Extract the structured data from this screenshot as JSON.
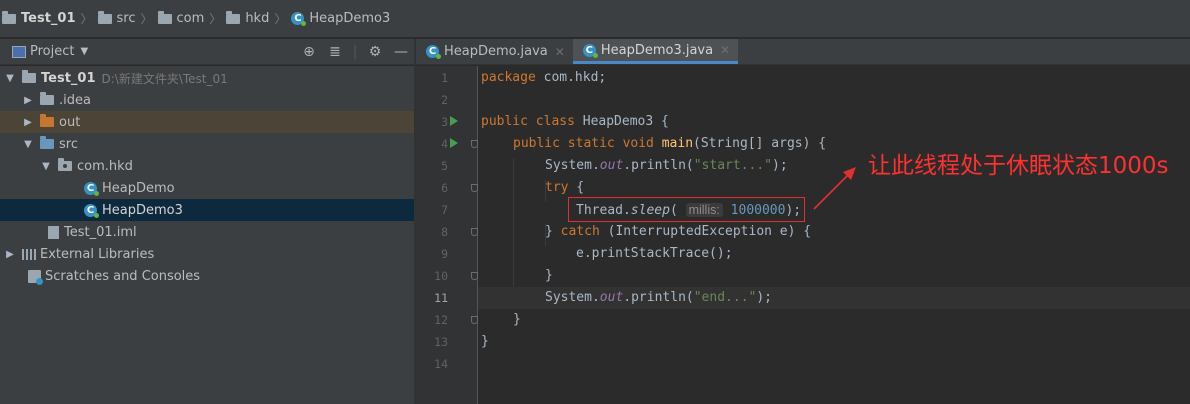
{
  "breadcrumb": {
    "project": "Test_01",
    "items": [
      "src",
      "com",
      "hkd"
    ],
    "file": "HeapDemo3"
  },
  "project_panel": {
    "title": "Project",
    "tree": {
      "root_name": "Test_01",
      "root_path": "D:\\新建文件夹\\Test_01",
      "idea": ".idea",
      "out": "out",
      "src": "src",
      "package": "com.hkd",
      "class1": "HeapDemo",
      "class2": "HeapDemo3",
      "iml": "Test_01.iml",
      "external": "External Libraries",
      "scratches": "Scratches and Consoles"
    }
  },
  "editor": {
    "tabs": [
      {
        "label": "HeapDemo.java",
        "active": false
      },
      {
        "label": "HeapDemo3.java",
        "active": true
      }
    ],
    "line_numbers": [
      "1",
      "2",
      "3",
      "4",
      "5",
      "6",
      "7",
      "8",
      "9",
      "10",
      "11",
      "12",
      "13",
      "14"
    ],
    "current_line": "11",
    "code": {
      "l1_kw": "package",
      "l1_rest": " com.hkd;",
      "l3_kw": "public class",
      "l3_rest": " HeapDemo3 {",
      "l4_kw": "public static void",
      "l4_fn": "main",
      "l4_rest": "(String[] args) {",
      "l5_a": "System.",
      "l5_out": "out",
      "l5_b": ".println(",
      "l5_str": "\"start...\"",
      "l5_c": ");",
      "l6_kw": "try",
      "l6_rest": " {",
      "l7_a": "Thread.",
      "l7_sleep": "sleep",
      "l7_b": "(",
      "l7_hint": "millis:",
      "l7_num": "1000000",
      "l7_c": ");",
      "l8_a": "} ",
      "l8_kw": "catch",
      "l8_rest": " (InterruptedException e) {",
      "l9": "e.printStackTrace();",
      "l10": "}",
      "l11_a": "System.",
      "l11_out": "out",
      "l11_b": ".println(",
      "l11_str": "\"end...\"",
      "l11_c": ");",
      "l12": "}",
      "l13": "}"
    }
  },
  "annotation": {
    "text": "让此线程处于休眠状态1000s",
    "color": "#ff3030"
  },
  "colors": {
    "keyword": "#cc7832",
    "function": "#ffc66d",
    "string": "#6a8759",
    "number": "#6897bb",
    "field": "#9876aa",
    "selection": "#0d293e",
    "tab_underline": "#4a88c7"
  }
}
